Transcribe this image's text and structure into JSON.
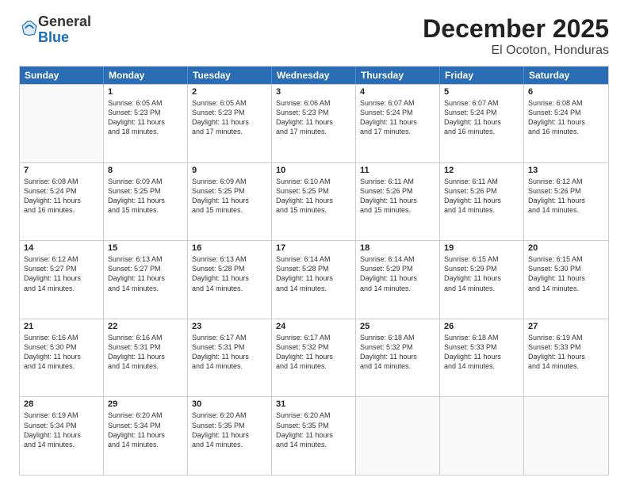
{
  "logo": {
    "general": "General",
    "blue": "Blue"
  },
  "title": "December 2025",
  "subtitle": "El Ocoton, Honduras",
  "headers": [
    "Sunday",
    "Monday",
    "Tuesday",
    "Wednesday",
    "Thursday",
    "Friday",
    "Saturday"
  ],
  "weeks": [
    [
      {
        "day": "",
        "info": ""
      },
      {
        "day": "1",
        "info": "Sunrise: 6:05 AM\nSunset: 5:23 PM\nDaylight: 11 hours\nand 18 minutes."
      },
      {
        "day": "2",
        "info": "Sunrise: 6:05 AM\nSunset: 5:23 PM\nDaylight: 11 hours\nand 17 minutes."
      },
      {
        "day": "3",
        "info": "Sunrise: 6:06 AM\nSunset: 5:23 PM\nDaylight: 11 hours\nand 17 minutes."
      },
      {
        "day": "4",
        "info": "Sunrise: 6:07 AM\nSunset: 5:24 PM\nDaylight: 11 hours\nand 17 minutes."
      },
      {
        "day": "5",
        "info": "Sunrise: 6:07 AM\nSunset: 5:24 PM\nDaylight: 11 hours\nand 16 minutes."
      },
      {
        "day": "6",
        "info": "Sunrise: 6:08 AM\nSunset: 5:24 PM\nDaylight: 11 hours\nand 16 minutes."
      }
    ],
    [
      {
        "day": "7",
        "info": "Sunrise: 6:08 AM\nSunset: 5:24 PM\nDaylight: 11 hours\nand 16 minutes."
      },
      {
        "day": "8",
        "info": "Sunrise: 6:09 AM\nSunset: 5:25 PM\nDaylight: 11 hours\nand 15 minutes."
      },
      {
        "day": "9",
        "info": "Sunrise: 6:09 AM\nSunset: 5:25 PM\nDaylight: 11 hours\nand 15 minutes."
      },
      {
        "day": "10",
        "info": "Sunrise: 6:10 AM\nSunset: 5:25 PM\nDaylight: 11 hours\nand 15 minutes."
      },
      {
        "day": "11",
        "info": "Sunrise: 6:11 AM\nSunset: 5:26 PM\nDaylight: 11 hours\nand 15 minutes."
      },
      {
        "day": "12",
        "info": "Sunrise: 6:11 AM\nSunset: 5:26 PM\nDaylight: 11 hours\nand 14 minutes."
      },
      {
        "day": "13",
        "info": "Sunrise: 6:12 AM\nSunset: 5:26 PM\nDaylight: 11 hours\nand 14 minutes."
      }
    ],
    [
      {
        "day": "14",
        "info": "Sunrise: 6:12 AM\nSunset: 5:27 PM\nDaylight: 11 hours\nand 14 minutes."
      },
      {
        "day": "15",
        "info": "Sunrise: 6:13 AM\nSunset: 5:27 PM\nDaylight: 11 hours\nand 14 minutes."
      },
      {
        "day": "16",
        "info": "Sunrise: 6:13 AM\nSunset: 5:28 PM\nDaylight: 11 hours\nand 14 minutes."
      },
      {
        "day": "17",
        "info": "Sunrise: 6:14 AM\nSunset: 5:28 PM\nDaylight: 11 hours\nand 14 minutes."
      },
      {
        "day": "18",
        "info": "Sunrise: 6:14 AM\nSunset: 5:29 PM\nDaylight: 11 hours\nand 14 minutes."
      },
      {
        "day": "19",
        "info": "Sunrise: 6:15 AM\nSunset: 5:29 PM\nDaylight: 11 hours\nand 14 minutes."
      },
      {
        "day": "20",
        "info": "Sunrise: 6:15 AM\nSunset: 5:30 PM\nDaylight: 11 hours\nand 14 minutes."
      }
    ],
    [
      {
        "day": "21",
        "info": "Sunrise: 6:16 AM\nSunset: 5:30 PM\nDaylight: 11 hours\nand 14 minutes."
      },
      {
        "day": "22",
        "info": "Sunrise: 6:16 AM\nSunset: 5:31 PM\nDaylight: 11 hours\nand 14 minutes."
      },
      {
        "day": "23",
        "info": "Sunrise: 6:17 AM\nSunset: 5:31 PM\nDaylight: 11 hours\nand 14 minutes."
      },
      {
        "day": "24",
        "info": "Sunrise: 6:17 AM\nSunset: 5:32 PM\nDaylight: 11 hours\nand 14 minutes."
      },
      {
        "day": "25",
        "info": "Sunrise: 6:18 AM\nSunset: 5:32 PM\nDaylight: 11 hours\nand 14 minutes."
      },
      {
        "day": "26",
        "info": "Sunrise: 6:18 AM\nSunset: 5:33 PM\nDaylight: 11 hours\nand 14 minutes."
      },
      {
        "day": "27",
        "info": "Sunrise: 6:19 AM\nSunset: 5:33 PM\nDaylight: 11 hours\nand 14 minutes."
      }
    ],
    [
      {
        "day": "28",
        "info": "Sunrise: 6:19 AM\nSunset: 5:34 PM\nDaylight: 11 hours\nand 14 minutes."
      },
      {
        "day": "29",
        "info": "Sunrise: 6:20 AM\nSunset: 5:34 PM\nDaylight: 11 hours\nand 14 minutes."
      },
      {
        "day": "30",
        "info": "Sunrise: 6:20 AM\nSunset: 5:35 PM\nDaylight: 11 hours\nand 14 minutes."
      },
      {
        "day": "31",
        "info": "Sunrise: 6:20 AM\nSunset: 5:35 PM\nDaylight: 11 hours\nand 14 minutes."
      },
      {
        "day": "",
        "info": ""
      },
      {
        "day": "",
        "info": ""
      },
      {
        "day": "",
        "info": ""
      }
    ]
  ]
}
